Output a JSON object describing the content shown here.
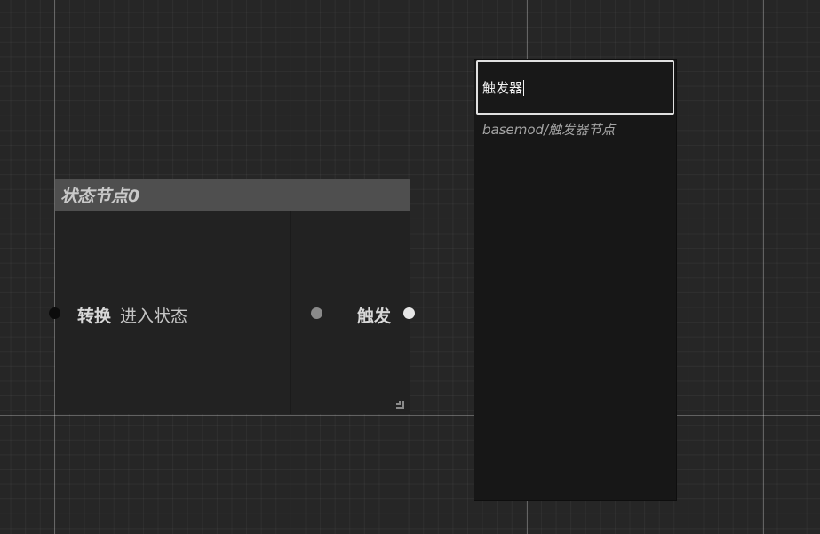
{
  "graph": {
    "background_color": "#262626"
  },
  "state_node": {
    "title": "状态节点0",
    "header_color": "#4f4f4f",
    "inputs": {
      "transition_label": "转换",
      "enter_state_label": "进入状态"
    },
    "outputs": {
      "trigger_label": "触发"
    },
    "pin_colors": {
      "transition": "#0c0c0c",
      "trigger_in": "#8a8a8a",
      "trigger_out": "#e6e6e6"
    }
  },
  "search_popup": {
    "query": "触发器",
    "results": [
      "basemod/触发器节点"
    ]
  }
}
